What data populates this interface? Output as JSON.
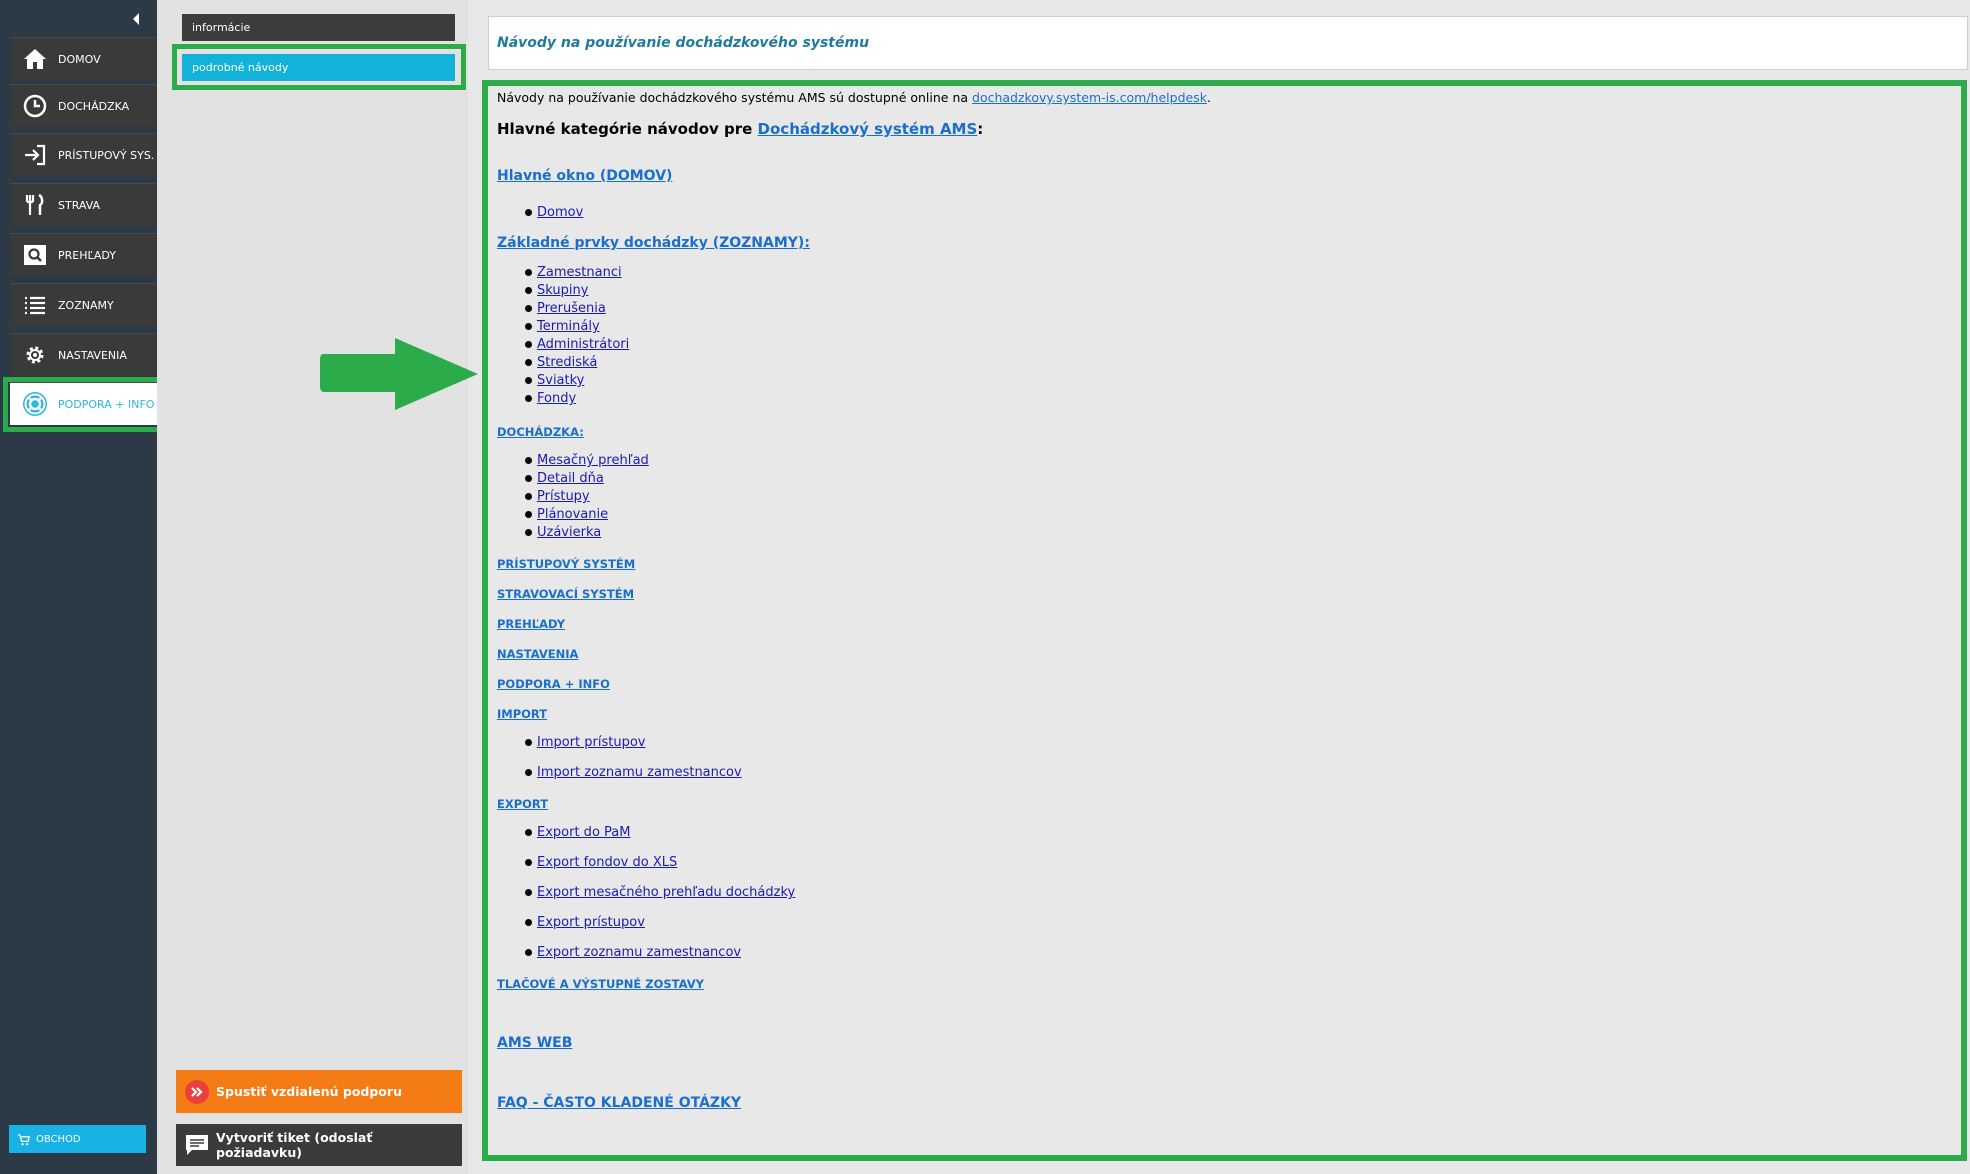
{
  "sidebar": {
    "items": [
      {
        "label": "DOMOV",
        "icon": "home-icon"
      },
      {
        "label": "DOCHÁDZKA",
        "icon": "clock-icon"
      },
      {
        "label": "PRÍSTUPOVÝ SYS.",
        "icon": "login-icon"
      },
      {
        "label": "STRAVA",
        "icon": "cutlery-icon"
      },
      {
        "label": "PREHĽADY",
        "icon": "search-icon"
      },
      {
        "label": "ZOZNAMY",
        "icon": "list-icon"
      },
      {
        "label": "NASTAVENIA",
        "icon": "gear-icon"
      },
      {
        "label": "PODPORA + INFO",
        "icon": "lifebuoy-icon"
      }
    ],
    "shop_label": "OBCHOD"
  },
  "subnav": {
    "info_label": "informácie",
    "guides_label": "podrobné návody",
    "remote_support_label": "Spustiť vzdialenú podporu",
    "ticket_label": "Vytvoriť tiket (odoslať požiadavku)"
  },
  "main": {
    "title": "Návody na používanie dochádzkového systému",
    "intro_text": "Návody na používanie dochádzkového systému AMS sú dostupné online na ",
    "intro_link": "dochadzkovy.system-is.com/helpdesk",
    "intro_end": ".",
    "heading_text": "Hlavné kategórie návodov pre ",
    "heading_link": "Dochádzkový systém AMS",
    "heading_end": ":",
    "sections": [
      {
        "title": "Hlavné okno (DOMOV)",
        "items": [
          "Domov"
        ]
      },
      {
        "title": "Základné prvky dochádzky (ZOZNAMY):",
        "items": [
          "Zamestnanci",
          "Skupiny",
          "Prerušenia",
          "Terminály",
          "Administrátori",
          "Strediská",
          "Sviatky",
          "Fondy"
        ]
      },
      {
        "title": "DOCHÁDZKA:",
        "items": [
          "Mesačný prehľad",
          "Detail dňa",
          "Prístupy",
          "Plánovanie",
          "Uzávierka"
        ]
      },
      {
        "title": "PRÍSTUPOVÝ SYSTÉM",
        "items": []
      },
      {
        "title": "STRAVOVACÍ SYSTÉM",
        "items": []
      },
      {
        "title": "PREHĽADY",
        "items": []
      },
      {
        "title": "NASTAVENIA",
        "items": []
      },
      {
        "title": "PODPORA + INFO",
        "items": []
      },
      {
        "title": "IMPORT",
        "items": [
          "Import prístupov",
          "Import zoznamu zamestnancov"
        ]
      },
      {
        "title": "EXPORT",
        "items": [
          "Export do PaM",
          "Export fondov do XLS",
          "Export mesačného prehľadu dochádzky",
          "Export prístupov",
          "Export zoznamu zamestnancov"
        ]
      },
      {
        "title": "TLAČOVÉ A VÝSTUPNÉ ZOSTAVY",
        "items": []
      },
      {
        "title": "AMS WEB",
        "items": []
      },
      {
        "title": "FAQ - ČASTO KLADENÉ OTÁZKY",
        "items": []
      }
    ]
  },
  "colors": {
    "highlight": "#2cab4a",
    "accent": "#13b3d9",
    "remote_button": "#f57c14",
    "sidebar": "#2c3a47"
  }
}
